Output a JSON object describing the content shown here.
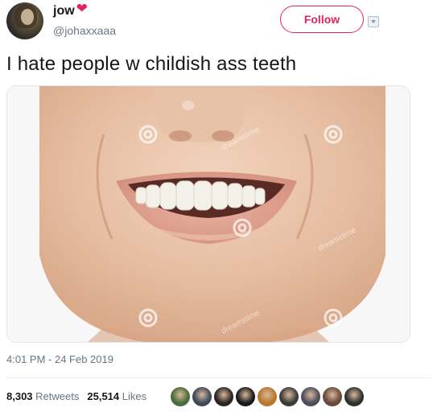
{
  "author": {
    "display_name": "jow",
    "handle": "@johaxxaaa",
    "name_badge_icon": "heart-icon",
    "avatar_icon": "profile-photo"
  },
  "follow_button": {
    "label": "Follow"
  },
  "tweet": {
    "text": "I hate people w childish ass teeth",
    "timestamp": "4:01 PM - 24 Feb 2019"
  },
  "media": {
    "watermark_text": "dreamstime"
  },
  "stats": {
    "retweets_count": "8,303",
    "retweets_label": "Retweets",
    "likes_count": "25,514",
    "likes_label": "Likes"
  },
  "likers": [
    "#4a6b3c",
    "#3e4a5a",
    "#2b2424",
    "#1a1a1a",
    "#b8772e",
    "#3a3a3a",
    "#4c4c5c",
    "#6a4a3a",
    "#2f2f2f"
  ],
  "colors": {
    "accent": "#e0245e",
    "text": "#14171a",
    "secondary": "#657786"
  }
}
